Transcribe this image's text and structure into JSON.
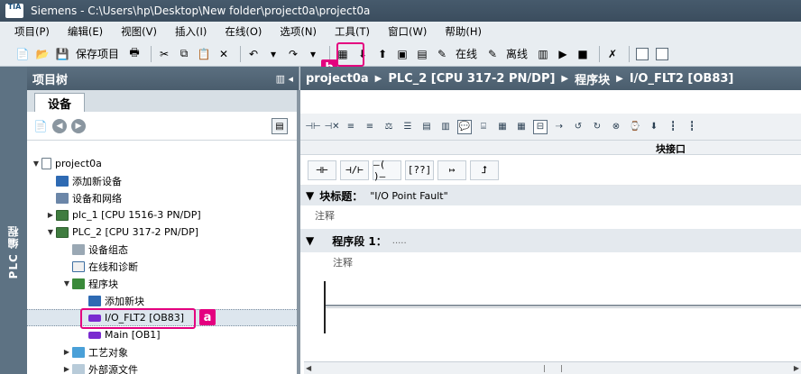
{
  "window": {
    "title": "Siemens  -  C:\\Users\\hp\\Desktop\\New folder\\project0a\\project0a",
    "logo": "TIA"
  },
  "menu": [
    "项目(P)",
    "编辑(E)",
    "视图(V)",
    "插入(I)",
    "在线(O)",
    "选项(N)",
    "工具(T)",
    "窗口(W)",
    "帮助(H)"
  ],
  "toolbar": {
    "save_label": "保存项目",
    "online_label": "在线",
    "offline_label": "离线"
  },
  "annotations": {
    "a": "a",
    "b": "b"
  },
  "left_strip": {
    "label": "PLC 编程"
  },
  "project_tree": {
    "title": "项目树",
    "tab": "设备",
    "items": [
      {
        "label": "project0a"
      },
      {
        "label": "添加新设备"
      },
      {
        "label": "设备和网络"
      },
      {
        "label": "plc_1 [CPU 1516-3 PN/DP]"
      },
      {
        "label": "PLC_2 [CPU 317-2 PN/DP]"
      },
      {
        "label": "设备组态"
      },
      {
        "label": "在线和诊断"
      },
      {
        "label": "程序块"
      },
      {
        "label": "添加新块"
      },
      {
        "label": "I/O_FLT2 [OB83]"
      },
      {
        "label": "Main [OB1]"
      },
      {
        "label": "工艺对象"
      },
      {
        "label": "外部源文件"
      }
    ]
  },
  "editor": {
    "breadcrumb": [
      "project0a",
      "PLC_2 [CPU 317-2 PN/DP]",
      "程序块",
      "I/O_FLT2 [OB83]"
    ],
    "interface_label": "块接口",
    "ladder_buttons": [
      "⊣⊢",
      "⊣/⊢",
      "–( )–",
      "[??]",
      "↦",
      "⮥"
    ],
    "block_title_label": "块标题：",
    "block_title_value": "\"I/O Point Fault\"",
    "block_comment": "注释",
    "network_label": "程序段 1：",
    "network_dots": ".....",
    "network_comment": "注释"
  },
  "colors": {
    "accent": "#e4007f",
    "header": "#4a5d6d",
    "block_icon": "#7a2bd0"
  }
}
